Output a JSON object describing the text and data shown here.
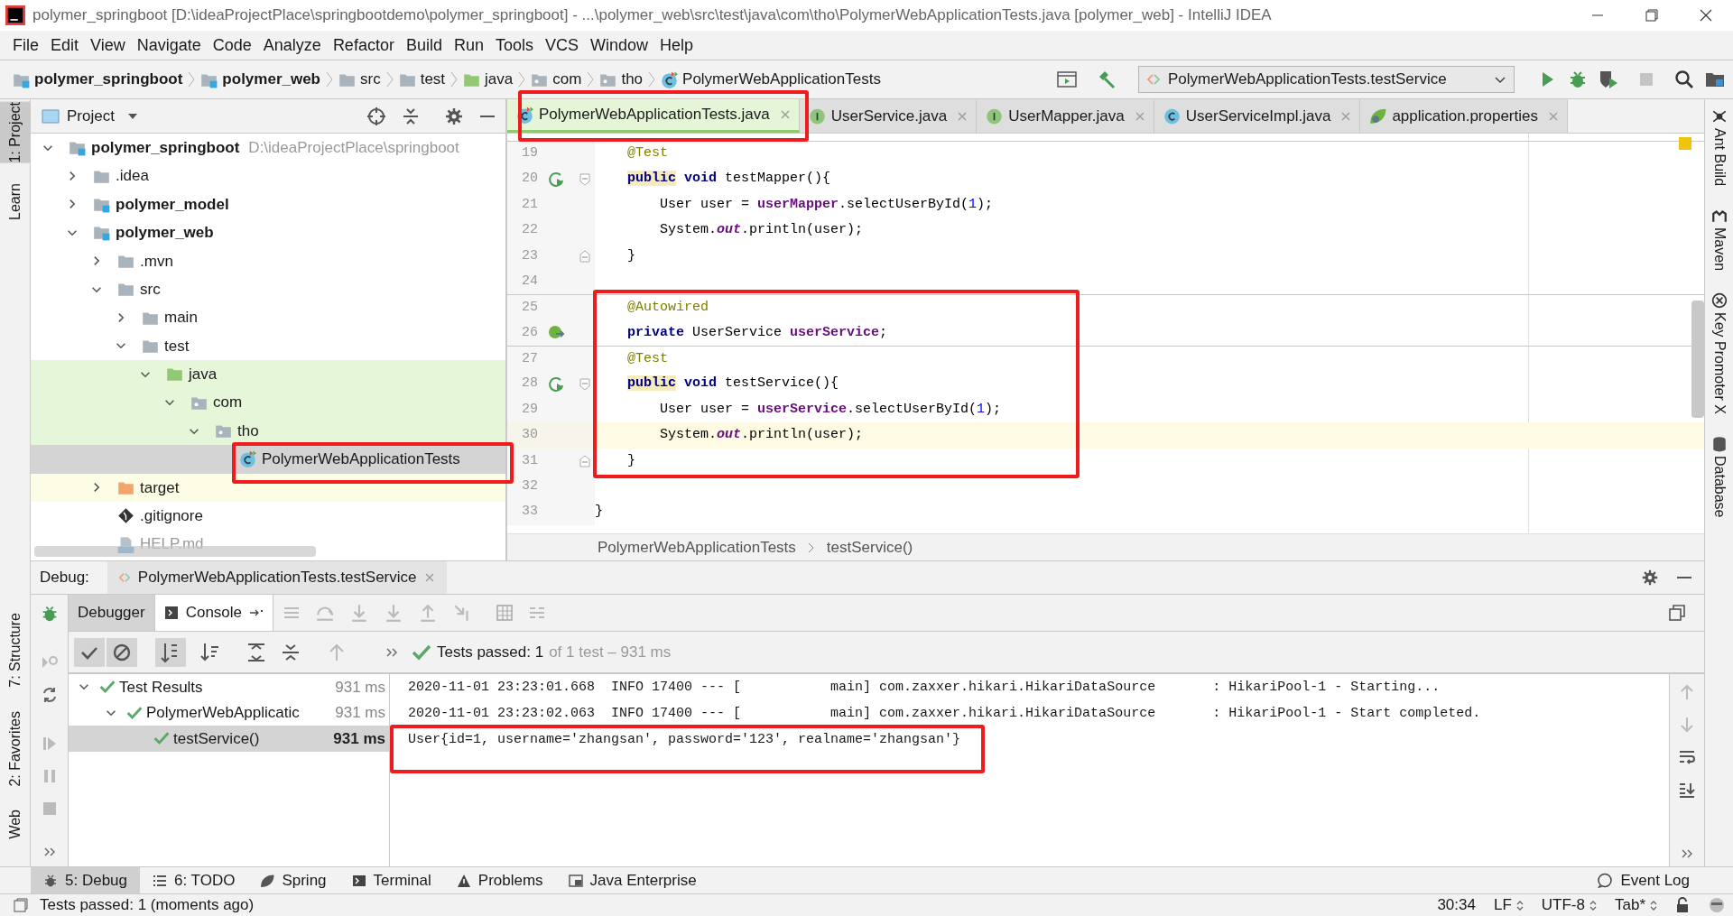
{
  "window": {
    "title": "polymer_springboot [D:\\ideaProjectPlace\\springbootdemo\\polymer_springboot] - ...\\polymer_web\\src\\test\\java\\com\\tho\\PolymerWebApplicationTests.java [polymer_web] - IntelliJ IDEA"
  },
  "menu": [
    "File",
    "Edit",
    "View",
    "Navigate",
    "Code",
    "Analyze",
    "Refactor",
    "Build",
    "Run",
    "Tools",
    "VCS",
    "Window",
    "Help"
  ],
  "navbar": {
    "breadcrumbs": [
      {
        "label": "polymer_springboot",
        "kind": "module",
        "bold": true
      },
      {
        "label": "polymer_web",
        "kind": "module",
        "bold": true
      },
      {
        "label": "src",
        "kind": "folder",
        "bold": false
      },
      {
        "label": "test",
        "kind": "folder",
        "bold": false
      },
      {
        "label": "java",
        "kind": "source",
        "bold": false
      },
      {
        "label": "com",
        "kind": "package",
        "bold": false
      },
      {
        "label": "tho",
        "kind": "package",
        "bold": false
      },
      {
        "label": "PolymerWebApplicationTests",
        "kind": "testclass",
        "bold": false
      }
    ],
    "run_config": "PolymerWebApplicationTests.testService"
  },
  "left_tool_strip": [
    {
      "label": "1: Project",
      "selected": true
    },
    {
      "label": "Learn",
      "selected": false
    },
    {
      "label": "7: Structure",
      "selected": false
    },
    {
      "label": "2: Favorites",
      "selected": false
    },
    {
      "label": "Web",
      "selected": false
    }
  ],
  "right_tool_strip": [
    {
      "label": "Ant Build",
      "kind": "ant"
    },
    {
      "label": "Maven",
      "kind": "maven"
    },
    {
      "label": "Key Promoter X",
      "kind": "key"
    },
    {
      "label": "Database",
      "kind": "database"
    }
  ],
  "project_panel": {
    "title": "Project",
    "tree": [
      {
        "label": "polymer_springboot",
        "kind": "module",
        "bold": true,
        "hint": "D:\\ideaProjectPlace\\springboot",
        "expanded": true,
        "selected": false,
        "children": [
          {
            "label": ".idea",
            "kind": "folder",
            "expanded": false,
            "selected": false
          },
          {
            "label": "polymer_model",
            "kind": "module",
            "bold": true,
            "expanded": false,
            "selected": false
          },
          {
            "label": "polymer_web",
            "kind": "module",
            "bold": true,
            "expanded": true,
            "selected": false,
            "children": [
              {
                "label": ".mvn",
                "kind": "folder",
                "expanded": false,
                "selected": false
              },
              {
                "label": "src",
                "kind": "folder",
                "expanded": true,
                "selected": false,
                "children": [
                  {
                    "label": "main",
                    "kind": "folder",
                    "expanded": false,
                    "selected": false
                  },
                  {
                    "label": "test",
                    "kind": "folder",
                    "expanded": true,
                    "selected": false,
                    "children": [
                      {
                        "label": "java",
                        "kind": "source",
                        "test_scope": true,
                        "expanded": true,
                        "selected": false,
                        "children": [
                          {
                            "label": "com",
                            "kind": "package",
                            "test_scope": true,
                            "expanded": true,
                            "selected": false,
                            "children": [
                              {
                                "label": "tho",
                                "kind": "package",
                                "test_scope": true,
                                "expanded": true,
                                "selected": false,
                                "children": [
                                  {
                                    "label": "PolymerWebApplicationTests",
                                    "kind": "testclass",
                                    "selected": true
                                  }
                                ]
                              }
                            ]
                          }
                        ]
                      }
                    ]
                  }
                ]
              },
              {
                "label": "target",
                "kind": "excluded",
                "excluded": true,
                "expanded": false,
                "selected": false
              },
              {
                "label": ".gitignore",
                "kind": "git",
                "selected": false
              },
              {
                "label": "HELP.md",
                "kind": "markdown",
                "dimmed": true,
                "selected": false
              }
            ]
          }
        ]
      }
    ]
  },
  "editor": {
    "tabs": [
      {
        "label": "PolymerWebApplicationTests.java",
        "kind": "testclass",
        "selected": true
      },
      {
        "label": "UserService.java",
        "kind": "interface",
        "selected": false
      },
      {
        "label": "UserMapper.java",
        "kind": "interface",
        "selected": false
      },
      {
        "label": "UserServiceImpl.java",
        "kind": "class",
        "selected": false
      },
      {
        "label": "application.properties",
        "kind": "spring",
        "selected": false
      }
    ],
    "lines": [
      {
        "number": "19",
        "separator": true,
        "tokens": [
          {
            "text": "    @Test",
            "kind": "annotation"
          }
        ]
      },
      {
        "number": "20",
        "run_marker": true,
        "fold_start": true,
        "tokens": [
          {
            "text": "    public",
            "kind": "keyword",
            "highlight": true
          },
          {
            "text": " void",
            "kind": "keyword"
          },
          {
            "text": " testMapper(){",
            "kind": "plain"
          }
        ]
      },
      {
        "number": "21",
        "tokens": [
          {
            "text": "        User user = ",
            "kind": "plain"
          },
          {
            "text": "userMapper",
            "kind": "field"
          },
          {
            "text": ".selectUserById(",
            "kind": "plain"
          },
          {
            "text": "1",
            "kind": "number"
          },
          {
            "text": ");",
            "kind": "plain"
          }
        ]
      },
      {
        "number": "22",
        "tokens": [
          {
            "text": "        System.",
            "kind": "plain"
          },
          {
            "text": "out",
            "kind": "static"
          },
          {
            "text": ".println(user);",
            "kind": "plain"
          }
        ]
      },
      {
        "number": "23",
        "fold_end": true,
        "tokens": [
          {
            "text": "    }",
            "kind": "plain"
          }
        ]
      },
      {
        "number": "24"
      },
      {
        "number": "25",
        "separator": true,
        "tokens": [
          {
            "text": "    @Autowired",
            "kind": "annotation"
          }
        ]
      },
      {
        "number": "26",
        "bean_marker": true,
        "tokens": [
          {
            "text": "    private",
            "kind": "keyword"
          },
          {
            "text": " UserService ",
            "kind": "plain"
          },
          {
            "text": "userService",
            "kind": "field"
          },
          {
            "text": ";",
            "kind": "plain"
          }
        ]
      },
      {
        "number": "27",
        "separator": true,
        "tokens": [
          {
            "text": "    @Test",
            "kind": "annotation"
          }
        ]
      },
      {
        "number": "28",
        "run_marker": true,
        "fold_start": true,
        "tokens": [
          {
            "text": "    public",
            "kind": "keyword",
            "highlight": true
          },
          {
            "text": " void",
            "kind": "keyword"
          },
          {
            "text": " testService(){",
            "kind": "plain"
          }
        ]
      },
      {
        "number": "29",
        "tokens": [
          {
            "text": "        User user = ",
            "kind": "plain"
          },
          {
            "text": "userService",
            "kind": "field"
          },
          {
            "text": ".selectUserById(",
            "kind": "plain"
          },
          {
            "text": "1",
            "kind": "number"
          },
          {
            "text": ");",
            "kind": "plain"
          }
        ]
      },
      {
        "number": "30",
        "current": true,
        "tokens": [
          {
            "text": "        System.",
            "kind": "plain"
          },
          {
            "text": "out",
            "kind": "static"
          },
          {
            "text": ".println(user);",
            "kind": "plain"
          }
        ]
      },
      {
        "number": "31",
        "fold_end": true,
        "tokens": [
          {
            "text": "    }",
            "kind": "plain"
          }
        ]
      },
      {
        "number": "32"
      },
      {
        "number": "33",
        "tokens": [
          {
            "text": "}",
            "kind": "plain"
          }
        ]
      }
    ],
    "breadcrumbs": [
      "PolymerWebApplicationTests",
      "testService()"
    ]
  },
  "debug": {
    "title": "Debug:",
    "session_tab": "PolymerWebApplicationTests.testService",
    "subtabs": [
      {
        "label": "Debugger",
        "selected": false
      },
      {
        "label": "Console",
        "selected": true
      }
    ],
    "status": {
      "summary": "Tests passed: 1",
      "detail": "of 1 test – 931 ms"
    },
    "test_tree": [
      {
        "label": "Test Results",
        "time": "931 ms",
        "passed": true,
        "expanded": true,
        "selected": false,
        "children": [
          {
            "label": "PolymerWebApplicatic",
            "time": "931 ms",
            "passed": true,
            "expanded": true,
            "selected": false,
            "children": [
              {
                "label": "testService()",
                "time": "931 ms",
                "passed": true,
                "selected": true
              }
            ]
          }
        ]
      }
    ],
    "console": [
      "2020-11-01 23:23:01.668  INFO 17400 --- [           main] com.zaxxer.hikari.HikariDataSource       : HikariPool-1 - Starting...",
      "2020-11-01 23:23:02.063  INFO 17400 --- [           main] com.zaxxer.hikari.HikariDataSource       : HikariPool-1 - Start completed.",
      "User{id=1, username='zhangsan', password='123', realname='zhangsan'}"
    ]
  },
  "tool_windows": [
    {
      "label": "5: Debug",
      "kind": "bug",
      "selected": true
    },
    {
      "label": "6: TODO",
      "kind": "list",
      "selected": false
    },
    {
      "label": "Spring",
      "kind": "spring",
      "selected": false
    },
    {
      "label": "Terminal",
      "kind": "terminal",
      "selected": false
    },
    {
      "label": "Problems",
      "kind": "warning",
      "selected": false
    },
    {
      "label": "Java Enterprise",
      "kind": "enterprise",
      "selected": false
    }
  ],
  "event_log": "Event Log",
  "status_bar": {
    "message": "Tests passed: 1 (moments ago)",
    "position": "30:34",
    "line_separator": "LF",
    "encoding": "UTF-8",
    "indent": "Tab*"
  },
  "annotations": [
    {
      "kind": "frame"
    },
    {
      "kind": "frame"
    },
    {
      "kind": "frame"
    },
    {
      "kind": "frame"
    }
  ]
}
